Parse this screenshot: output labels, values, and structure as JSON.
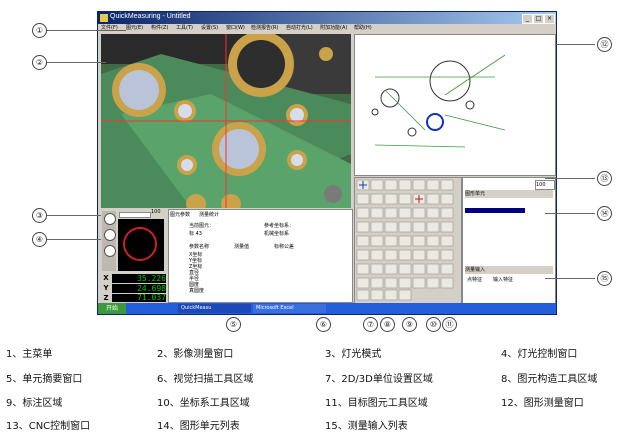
{
  "window": {
    "title": "QuickMeasuring - Untitled",
    "menu": [
      "文件(F)",
      "图元(E)",
      "构件(Z)",
      "工具(T)",
      "设置(S)",
      "窗口(W)",
      "检测报告(R)",
      "自动打光(L)",
      "附加功能(A)",
      "帮助(H)"
    ]
  },
  "panels": {
    "summary_tab1": "图元参数",
    "summary_tab2": "测量统计",
    "summary_line1": "当前图元：",
    "summary_line2": "标 43",
    "summary_ref1": "参考坐标系：",
    "summary_ref2": "机械坐标系",
    "summary_headers": [
      "参数名称",
      "测量值",
      "标称公差"
    ],
    "summary_rows": [
      "X坐标",
      "Y坐标",
      "Z坐标",
      "直径",
      "半径",
      "圆度",
      "真圆度"
    ],
    "list_header": "图形单元",
    "list_header2": "测量输入",
    "list_sub": [
      "点特征",
      "输入特征"
    ],
    "zoom_value": "100"
  },
  "dro": {
    "x_label": "X",
    "x_value": "35.226",
    "y_label": "Y",
    "y_value": "24.698",
    "z_label": "Z",
    "z_value": "71.037"
  },
  "taskbar": {
    "item1": "QuickMeasu",
    "item2": "Microsoft Excel",
    "start": "开始"
  },
  "callouts": [
    "①",
    "②",
    "③",
    "④",
    "⑤",
    "⑥",
    "⑦",
    "⑧",
    "⑨",
    "⑩",
    "⑪",
    "⑫",
    "⑬",
    "⑭",
    "⑮"
  ],
  "legend": [
    "1、主菜单",
    "2、影像测量窗口",
    "3、灯光模式",
    "4、灯光控制窗口",
    "5、单元摘要窗口",
    "6、视觉扫描工具区域",
    "7、2D/3D单位设置区域",
    "8、图元构造工具区域",
    "9、标注区域",
    "10、坐标系工具区域",
    "11、目标图元工具区域",
    "12、图形测量窗口",
    "13、CNC控制窗口",
    "14、图形单元列表",
    "15、测量输入列表"
  ],
  "colors": {
    "accent": "#0a246a",
    "video_green": "#3f6a44",
    "dro_text": "#00c800",
    "selection": "#ff0000"
  }
}
